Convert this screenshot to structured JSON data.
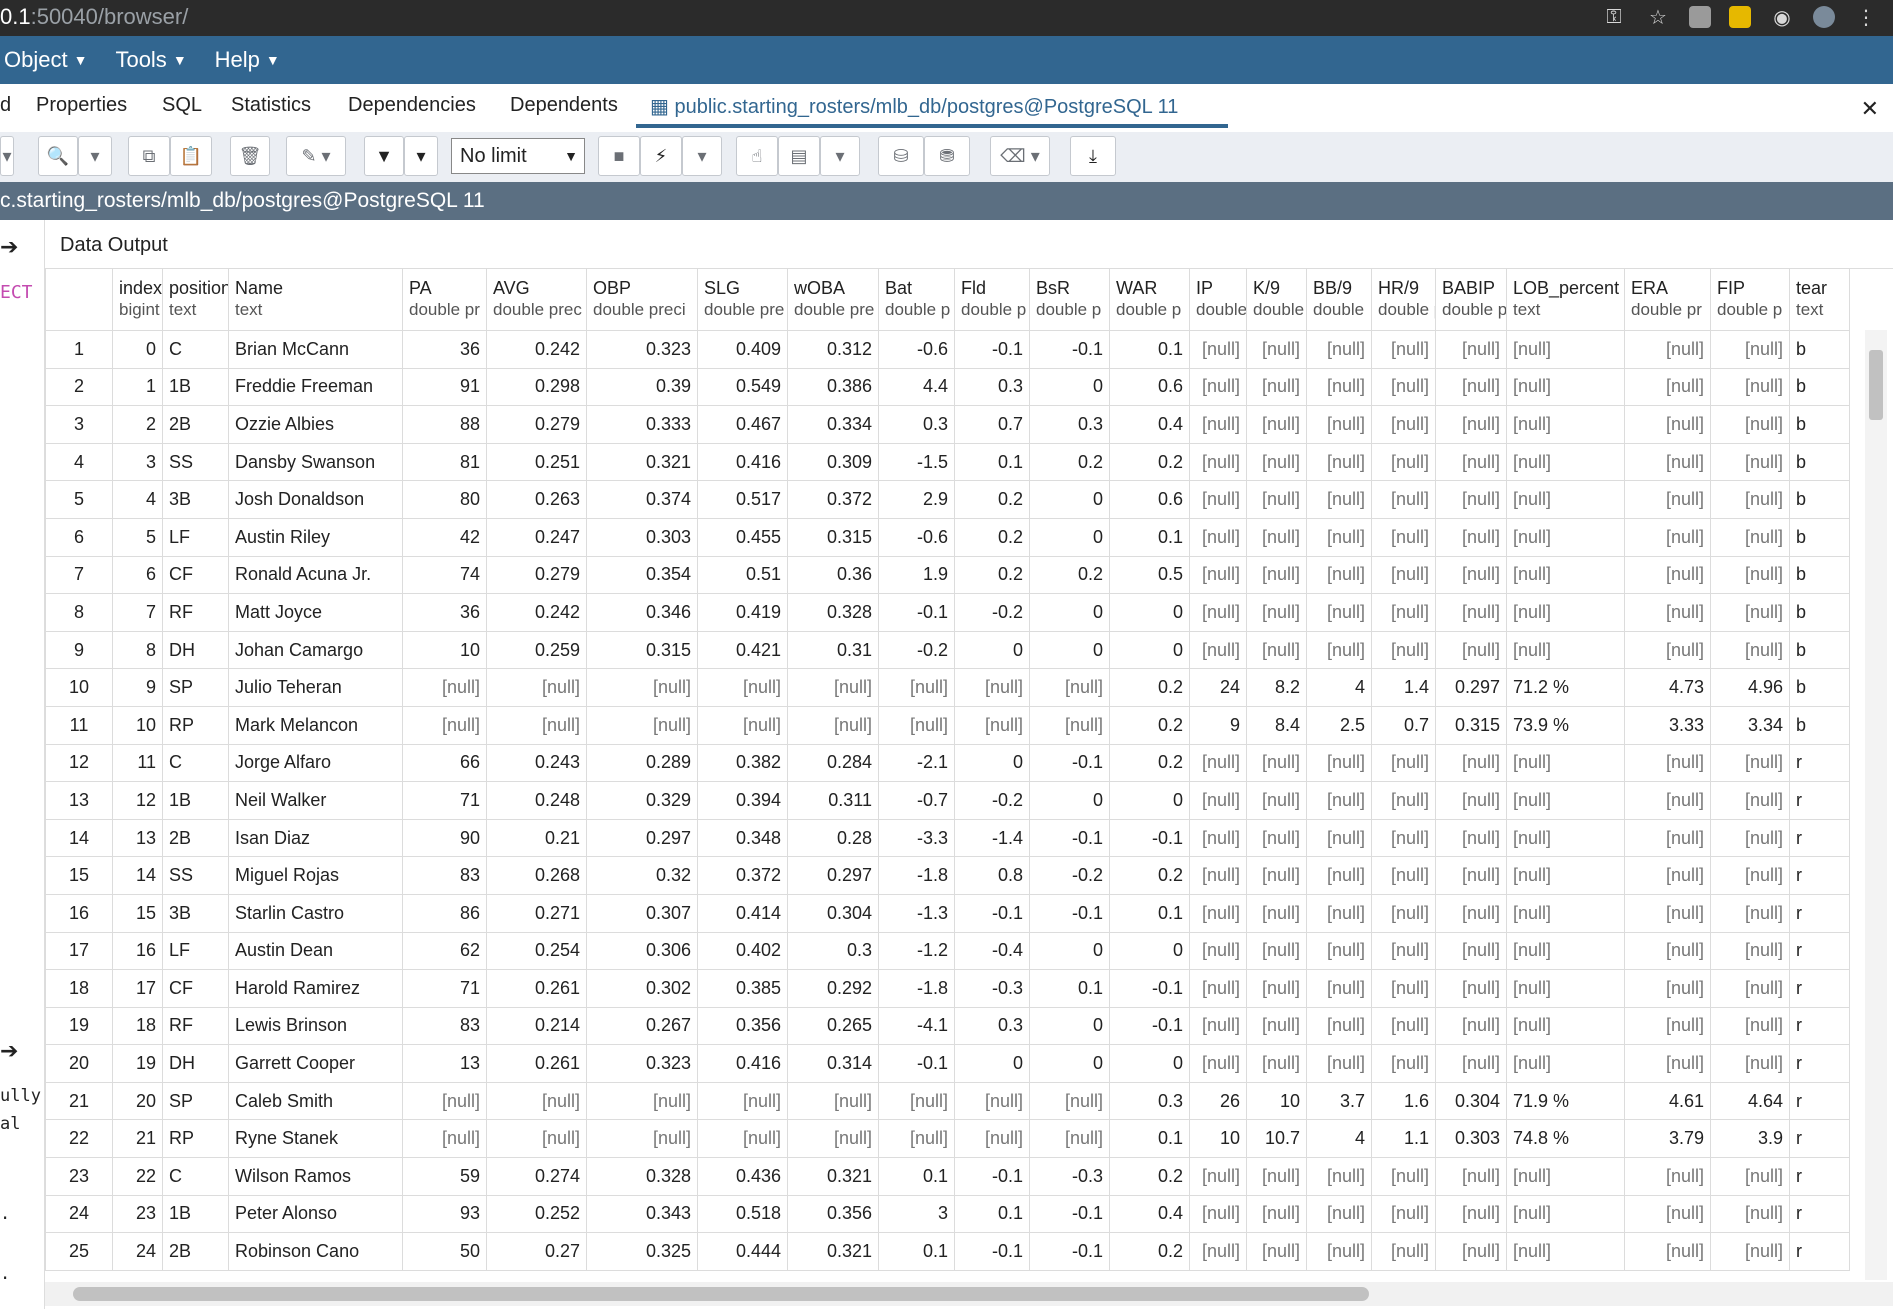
{
  "browser": {
    "url_host": "0.1",
    "url_rest": ":50040/browser/"
  },
  "menu": [
    {
      "label": "Object"
    },
    {
      "label": "Tools"
    },
    {
      "label": "Help"
    }
  ],
  "tabs": {
    "partial": "d",
    "items": [
      "Properties",
      "SQL",
      "Statistics",
      "Dependencies",
      "Dependents"
    ],
    "active": "public.starting_rosters/mlb_db/postgres@PostgreSQL 11"
  },
  "toolbar": {
    "limit": "No limit"
  },
  "query_title": "c.starting_rosters/mlb_db/postgres@PostgreSQL 11",
  "left_panel": {
    "ect": "ECT",
    "code1": "ully",
    "code2": "al",
    "code3": ".",
    "code4": "."
  },
  "data_output_label": "Data Output",
  "columns": [
    {
      "name": "index",
      "type": "bigint"
    },
    {
      "name": "position",
      "type": "text"
    },
    {
      "name": "Name",
      "type": "text"
    },
    {
      "name": "PA",
      "type": "double pr"
    },
    {
      "name": "AVG",
      "type": "double prec"
    },
    {
      "name": "OBP",
      "type": "double preci"
    },
    {
      "name": "SLG",
      "type": "double pre"
    },
    {
      "name": "wOBA",
      "type": "double pre"
    },
    {
      "name": "Bat",
      "type": "double p"
    },
    {
      "name": "Fld",
      "type": "double p"
    },
    {
      "name": "BsR",
      "type": "double p"
    },
    {
      "name": "WAR",
      "type": "double p"
    },
    {
      "name": "IP",
      "type": "double"
    },
    {
      "name": "K/9",
      "type": "double"
    },
    {
      "name": "BB/9",
      "type": "double"
    },
    {
      "name": "HR/9",
      "type": "double p"
    },
    {
      "name": "BABIP",
      "type": "double p"
    },
    {
      "name": "LOB_percent",
      "type": "text"
    },
    {
      "name": "ERA",
      "type": "double pr"
    },
    {
      "name": "FIP",
      "type": "double p"
    },
    {
      "name": "tear",
      "type": "text"
    }
  ],
  "rows": [
    [
      "0",
      "C",
      "Brian McCann",
      "36",
      "0.242",
      "0.323",
      "0.409",
      "0.312",
      "-0.6",
      "-0.1",
      "-0.1",
      "0.1",
      "[null]",
      "[null]",
      "[null]",
      "[null]",
      "[null]",
      "[null]",
      "[null]",
      "[null]",
      "b"
    ],
    [
      "1",
      "1B",
      "Freddie Freeman",
      "91",
      "0.298",
      "0.39",
      "0.549",
      "0.386",
      "4.4",
      "0.3",
      "0",
      "0.6",
      "[null]",
      "[null]",
      "[null]",
      "[null]",
      "[null]",
      "[null]",
      "[null]",
      "[null]",
      "b"
    ],
    [
      "2",
      "2B",
      "Ozzie Albies",
      "88",
      "0.279",
      "0.333",
      "0.467",
      "0.334",
      "0.3",
      "0.7",
      "0.3",
      "0.4",
      "[null]",
      "[null]",
      "[null]",
      "[null]",
      "[null]",
      "[null]",
      "[null]",
      "[null]",
      "b"
    ],
    [
      "3",
      "SS",
      "Dansby Swanson",
      "81",
      "0.251",
      "0.321",
      "0.416",
      "0.309",
      "-1.5",
      "0.1",
      "0.2",
      "0.2",
      "[null]",
      "[null]",
      "[null]",
      "[null]",
      "[null]",
      "[null]",
      "[null]",
      "[null]",
      "b"
    ],
    [
      "4",
      "3B",
      "Josh Donaldson",
      "80",
      "0.263",
      "0.374",
      "0.517",
      "0.372",
      "2.9",
      "0.2",
      "0",
      "0.6",
      "[null]",
      "[null]",
      "[null]",
      "[null]",
      "[null]",
      "[null]",
      "[null]",
      "[null]",
      "b"
    ],
    [
      "5",
      "LF",
      "Austin Riley",
      "42",
      "0.247",
      "0.303",
      "0.455",
      "0.315",
      "-0.6",
      "0.2",
      "0",
      "0.1",
      "[null]",
      "[null]",
      "[null]",
      "[null]",
      "[null]",
      "[null]",
      "[null]",
      "[null]",
      "b"
    ],
    [
      "6",
      "CF",
      "Ronald Acuna Jr.",
      "74",
      "0.279",
      "0.354",
      "0.51",
      "0.36",
      "1.9",
      "0.2",
      "0.2",
      "0.5",
      "[null]",
      "[null]",
      "[null]",
      "[null]",
      "[null]",
      "[null]",
      "[null]",
      "[null]",
      "b"
    ],
    [
      "7",
      "RF",
      "Matt Joyce",
      "36",
      "0.242",
      "0.346",
      "0.419",
      "0.328",
      "-0.1",
      "-0.2",
      "0",
      "0",
      "[null]",
      "[null]",
      "[null]",
      "[null]",
      "[null]",
      "[null]",
      "[null]",
      "[null]",
      "b"
    ],
    [
      "8",
      "DH",
      "Johan Camargo",
      "10",
      "0.259",
      "0.315",
      "0.421",
      "0.31",
      "-0.2",
      "0",
      "0",
      "0",
      "[null]",
      "[null]",
      "[null]",
      "[null]",
      "[null]",
      "[null]",
      "[null]",
      "[null]",
      "b"
    ],
    [
      "9",
      "SP",
      "Julio Teheran",
      "[null]",
      "[null]",
      "[null]",
      "[null]",
      "[null]",
      "[null]",
      "[null]",
      "[null]",
      "0.2",
      "24",
      "8.2",
      "4",
      "1.4",
      "0.297",
      "71.2 %",
      "4.73",
      "4.96",
      "b"
    ],
    [
      "10",
      "RP",
      "Mark Melancon",
      "[null]",
      "[null]",
      "[null]",
      "[null]",
      "[null]",
      "[null]",
      "[null]",
      "[null]",
      "0.2",
      "9",
      "8.4",
      "2.5",
      "0.7",
      "0.315",
      "73.9 %",
      "3.33",
      "3.34",
      "b"
    ],
    [
      "11",
      "C",
      "Jorge Alfaro",
      "66",
      "0.243",
      "0.289",
      "0.382",
      "0.284",
      "-2.1",
      "0",
      "-0.1",
      "0.2",
      "[null]",
      "[null]",
      "[null]",
      "[null]",
      "[null]",
      "[null]",
      "[null]",
      "[null]",
      "r"
    ],
    [
      "12",
      "1B",
      "Neil Walker",
      "71",
      "0.248",
      "0.329",
      "0.394",
      "0.311",
      "-0.7",
      "-0.2",
      "0",
      "0",
      "[null]",
      "[null]",
      "[null]",
      "[null]",
      "[null]",
      "[null]",
      "[null]",
      "[null]",
      "r"
    ],
    [
      "13",
      "2B",
      "Isan Diaz",
      "90",
      "0.21",
      "0.297",
      "0.348",
      "0.28",
      "-3.3",
      "-1.4",
      "-0.1",
      "-0.1",
      "[null]",
      "[null]",
      "[null]",
      "[null]",
      "[null]",
      "[null]",
      "[null]",
      "[null]",
      "r"
    ],
    [
      "14",
      "SS",
      "Miguel Rojas",
      "83",
      "0.268",
      "0.32",
      "0.372",
      "0.297",
      "-1.8",
      "0.8",
      "-0.2",
      "0.2",
      "[null]",
      "[null]",
      "[null]",
      "[null]",
      "[null]",
      "[null]",
      "[null]",
      "[null]",
      "r"
    ],
    [
      "15",
      "3B",
      "Starlin Castro",
      "86",
      "0.271",
      "0.307",
      "0.414",
      "0.304",
      "-1.3",
      "-0.1",
      "-0.1",
      "0.1",
      "[null]",
      "[null]",
      "[null]",
      "[null]",
      "[null]",
      "[null]",
      "[null]",
      "[null]",
      "r"
    ],
    [
      "16",
      "LF",
      "Austin Dean",
      "62",
      "0.254",
      "0.306",
      "0.402",
      "0.3",
      "-1.2",
      "-0.4",
      "0",
      "0",
      "[null]",
      "[null]",
      "[null]",
      "[null]",
      "[null]",
      "[null]",
      "[null]",
      "[null]",
      "r"
    ],
    [
      "17",
      "CF",
      "Harold Ramirez",
      "71",
      "0.261",
      "0.302",
      "0.385",
      "0.292",
      "-1.8",
      "-0.3",
      "0.1",
      "-0.1",
      "[null]",
      "[null]",
      "[null]",
      "[null]",
      "[null]",
      "[null]",
      "[null]",
      "[null]",
      "r"
    ],
    [
      "18",
      "RF",
      "Lewis Brinson",
      "83",
      "0.214",
      "0.267",
      "0.356",
      "0.265",
      "-4.1",
      "0.3",
      "0",
      "-0.1",
      "[null]",
      "[null]",
      "[null]",
      "[null]",
      "[null]",
      "[null]",
      "[null]",
      "[null]",
      "r"
    ],
    [
      "19",
      "DH",
      "Garrett Cooper",
      "13",
      "0.261",
      "0.323",
      "0.416",
      "0.314",
      "-0.1",
      "0",
      "0",
      "0",
      "[null]",
      "[null]",
      "[null]",
      "[null]",
      "[null]",
      "[null]",
      "[null]",
      "[null]",
      "r"
    ],
    [
      "20",
      "SP",
      "Caleb Smith",
      "[null]",
      "[null]",
      "[null]",
      "[null]",
      "[null]",
      "[null]",
      "[null]",
      "[null]",
      "0.3",
      "26",
      "10",
      "3.7",
      "1.6",
      "0.304",
      "71.9 %",
      "4.61",
      "4.64",
      "r"
    ],
    [
      "21",
      "RP",
      "Ryne Stanek",
      "[null]",
      "[null]",
      "[null]",
      "[null]",
      "[null]",
      "[null]",
      "[null]",
      "[null]",
      "0.1",
      "10",
      "10.7",
      "4",
      "1.1",
      "0.303",
      "74.8 %",
      "3.79",
      "3.9",
      "r"
    ],
    [
      "22",
      "C",
      "Wilson Ramos",
      "59",
      "0.274",
      "0.328",
      "0.436",
      "0.321",
      "0.1",
      "-0.1",
      "-0.3",
      "0.2",
      "[null]",
      "[null]",
      "[null]",
      "[null]",
      "[null]",
      "[null]",
      "[null]",
      "[null]",
      "r"
    ],
    [
      "23",
      "1B",
      "Peter Alonso",
      "93",
      "0.252",
      "0.343",
      "0.518",
      "0.356",
      "3",
      "0.1",
      "-0.1",
      "0.4",
      "[null]",
      "[null]",
      "[null]",
      "[null]",
      "[null]",
      "[null]",
      "[null]",
      "[null]",
      "r"
    ],
    [
      "24",
      "2B",
      "Robinson Cano",
      "50",
      "0.27",
      "0.325",
      "0.444",
      "0.321",
      "0.1",
      "-0.1",
      "-0.1",
      "0.2",
      "[null]",
      "[null]",
      "[null]",
      "[null]",
      "[null]",
      "[null]",
      "[null]",
      "[null]",
      "r"
    ]
  ]
}
